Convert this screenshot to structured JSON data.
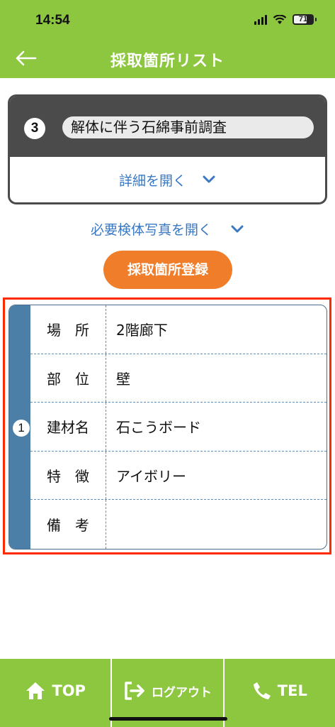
{
  "status_bar": {
    "time": "14:54",
    "battery": "71"
  },
  "header": {
    "title": "採取箇所リスト",
    "back_icon": "arrow-left-icon"
  },
  "survey": {
    "number": "3",
    "name": "解体に伴う石綿事前調査",
    "detail_toggle_label": "詳細を開く"
  },
  "photo_toggle_label": "必要検体写真を開く",
  "register_button_label": "採取箇所登録",
  "sample": {
    "number": "1",
    "rows": [
      {
        "label": "場　所",
        "value": "2階廊下"
      },
      {
        "label": "部　位",
        "value": "壁"
      },
      {
        "label": "建材名",
        "value": "石こうボード"
      },
      {
        "label": "特　徴",
        "value": "アイボリー"
      },
      {
        "label": "備　考",
        "value": ""
      }
    ]
  },
  "bottom_nav": {
    "top_label": "TOP",
    "logout_label": "ログアウト",
    "tel_label": "TEL"
  },
  "colors": {
    "header_green": "#8dc63f",
    "register_orange": "#f07d2a",
    "highlight_red": "#ff2a00",
    "strip_blue": "#4b7fa8",
    "link_blue": "#3a78c2"
  }
}
